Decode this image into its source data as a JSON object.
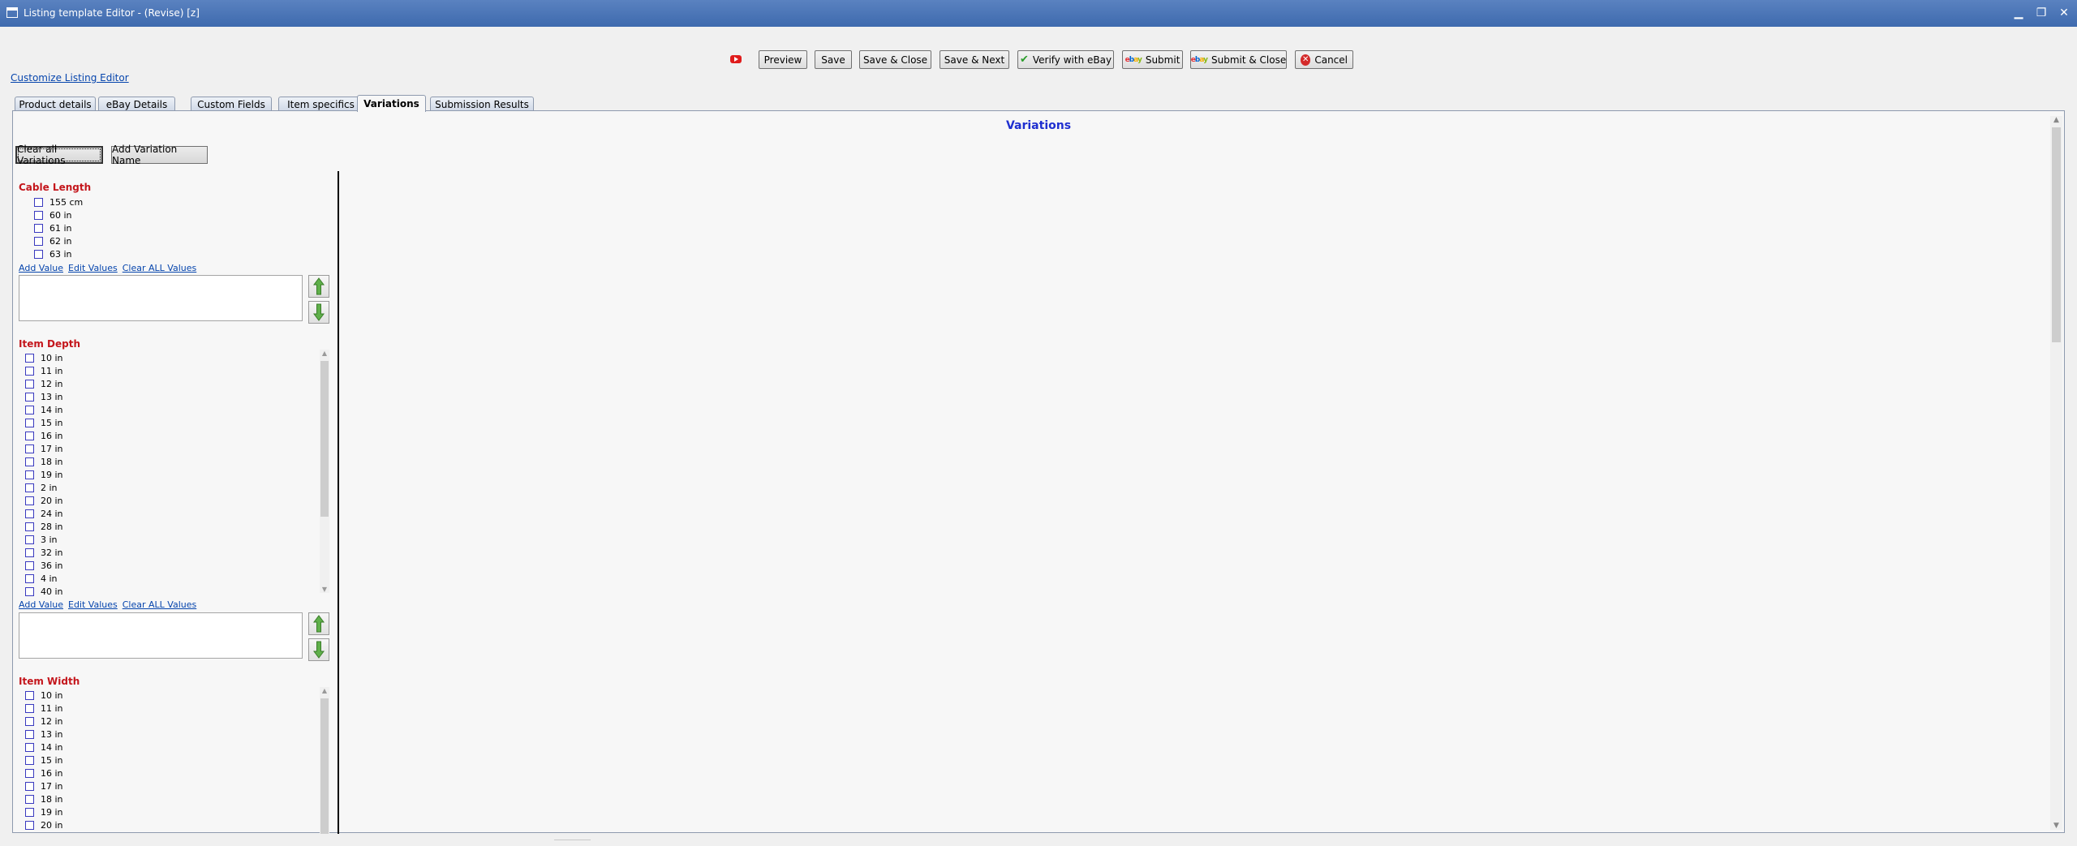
{
  "window": {
    "title": "Listing template Editor - (Revise) [z]",
    "controls": {
      "minimize": "▁",
      "restore": "❐",
      "close": "✕"
    }
  },
  "toolbar": {
    "youtube_icon": "youtube-icon",
    "buttons": {
      "preview": "Preview",
      "save": "Save",
      "save_close": "Save & Close",
      "save_next": "Save & Next",
      "verify": "Verify with eBay",
      "submit": "Submit",
      "submit_close": "Submit & Close",
      "cancel": "Cancel"
    }
  },
  "customize_link": "Customize Listing Editor",
  "tabs": [
    {
      "label": "Product details",
      "active": false
    },
    {
      "label": "eBay Details",
      "active": false
    },
    {
      "label": "Custom Fields",
      "active": false
    },
    {
      "label": "Item specifics",
      "active": false
    },
    {
      "label": "Variations",
      "active": true
    },
    {
      "label": "Submission Results",
      "active": false
    }
  ],
  "variations": {
    "heading": "Variations",
    "clear_all_label": "Clear all Variations",
    "add_name_label": "Add Variation Name",
    "link_add": "Add Value",
    "link_edit": "Edit Values",
    "link_clear": "Clear ALL Values",
    "groups": [
      {
        "name": "Cable Length",
        "values": [
          "155 cm",
          "60 in",
          "61 in",
          "62 in",
          "63 in"
        ]
      },
      {
        "name": "Item Depth",
        "values": [
          "10 in",
          "11 in",
          "12 in",
          "13 in",
          "14 in",
          "15 in",
          "16 in",
          "17 in",
          "18 in",
          "19 in",
          "2 in",
          "20 in",
          "24 in",
          "28 in",
          "3 in",
          "32 in",
          "36 in",
          "4 in",
          "40 in"
        ]
      },
      {
        "name": "Item Width",
        "values": [
          "10 in",
          "11 in",
          "12 in",
          "13 in",
          "14 in",
          "15 in",
          "16 in",
          "17 in",
          "18 in",
          "19 in",
          "20 in"
        ]
      }
    ]
  },
  "colors": {
    "titlebar": "#3e6aae",
    "variation_name": "#c4161c",
    "heading": "#1f2fd0",
    "link": "#0645ad"
  }
}
